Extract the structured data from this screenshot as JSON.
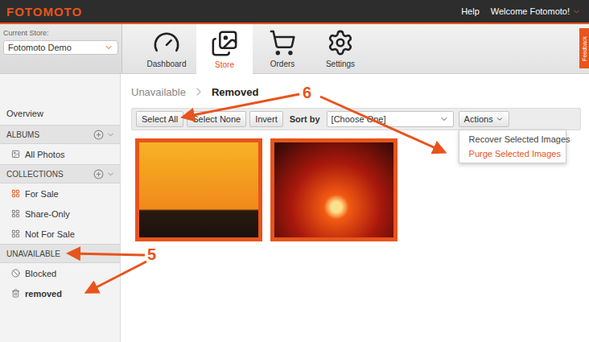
{
  "header": {
    "logo": "FOTOMOTO",
    "links": [
      "Help",
      "Welcome Fotomoto!"
    ]
  },
  "store": {
    "label": "Current Store:",
    "value": "Fotomoto Demo"
  },
  "nav": [
    {
      "label": "Dashboard",
      "selected": false
    },
    {
      "label": "Store",
      "selected": true
    },
    {
      "label": "Orders",
      "selected": false
    },
    {
      "label": "Settings",
      "selected": false
    }
  ],
  "feedback": "Feedback",
  "sidebar": {
    "items": [
      {
        "kind": "link",
        "label": "Overview",
        "selected": false
      },
      {
        "kind": "header",
        "label": "ALBUMS",
        "addable": true
      },
      {
        "kind": "link",
        "label": "All Photos",
        "selected": false
      },
      {
        "kind": "header",
        "label": "COLLECTIONS",
        "addable": true
      },
      {
        "kind": "link",
        "label": "For Sale",
        "selected": false
      },
      {
        "kind": "link",
        "label": "Share-Only",
        "selected": false
      },
      {
        "kind": "link",
        "label": "Not For Sale",
        "selected": false
      },
      {
        "kind": "header",
        "label": "UNAVAILABLE",
        "addable": false
      },
      {
        "kind": "link",
        "label": "Blocked",
        "selected": false
      },
      {
        "kind": "link",
        "label": "removed",
        "selected": true
      }
    ]
  },
  "breadcrumb": [
    "Unavailable",
    "Removed"
  ],
  "toolbar": {
    "buttons": [
      "Select All",
      "Select None",
      "Invert"
    ],
    "sort": {
      "label": "Sort by",
      "value": "[Choose One]"
    },
    "actions": {
      "label": "Actions",
      "expanded": true,
      "items": [
        {
          "label": "Recover Selected Images",
          "highlighted": false
        },
        {
          "label": "Purge Selected Images",
          "highlighted": true
        }
      ]
    }
  },
  "images": [
    {
      "selected": true
    },
    {
      "selected": true
    }
  ],
  "annotations": [
    {
      "label": "6"
    },
    {
      "label": "5"
    }
  ]
}
